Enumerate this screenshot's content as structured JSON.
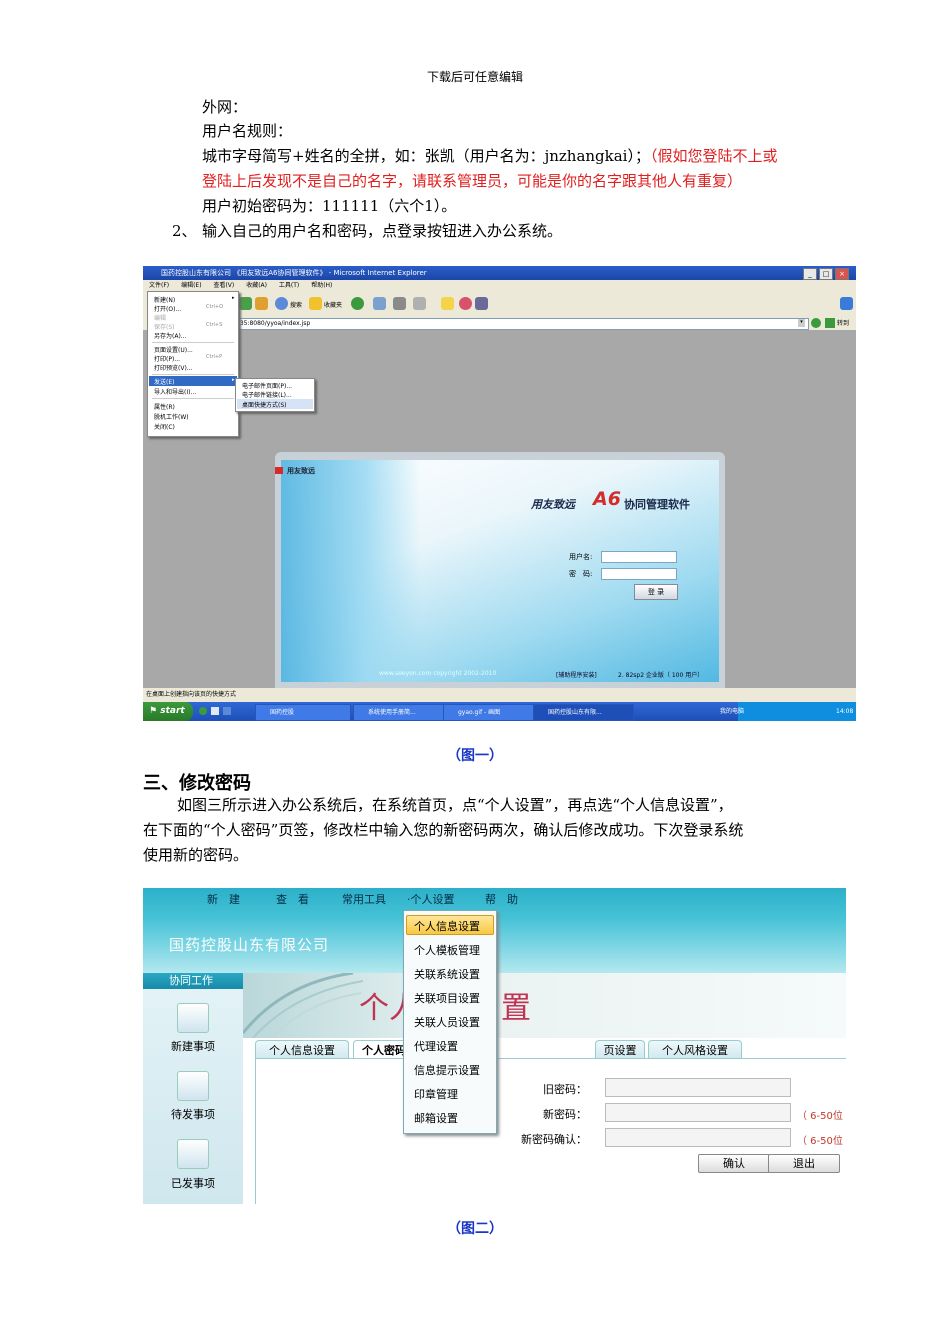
{
  "header": "下载后可任意编辑",
  "paragraphs": {
    "p1": "外网：",
    "p2": "用户名规则：",
    "p3a": "城市字母简写+姓名的全拼，如：张凯（用户名为：jnzhangkai）；",
    "p3b": "（假如您登陆不上或",
    "p4": "登陆上后发现不是自己的名字，请联系管理员，可能是你的名字跟其他人有重复）",
    "p5": "用户初始密码为：111111（六个1）。",
    "step2_num": "2、",
    "step2": "输入自己的用户名和密码，点登录按钮进入办公系统。"
  },
  "figure1": {
    "caption": "（图一）",
    "title_bar": "国药控股山东有限公司 《用友致远A6协同管理软件》 - Microsoft Internet Explorer",
    "menubar": [
      "文件(F)",
      "编辑(E)",
      "查看(V)",
      "收藏(A)",
      "工具(T)",
      "帮助(H)"
    ],
    "toolbar": {
      "search": "搜索",
      "favorites": "收藏夹"
    },
    "address": "235:8080/yyoa/index.jsp",
    "go": "转到",
    "file_menu": [
      {
        "label": "新建(N)",
        "shortcut": ""
      },
      {
        "label": "打开(O)...",
        "shortcut": "Ctrl+O"
      },
      {
        "label": "编辑",
        "shortcut": ""
      },
      {
        "label": "保存(S)",
        "shortcut": "Ctrl+S"
      },
      {
        "label": "另存为(A)...",
        "shortcut": ""
      },
      {
        "label": "页面设置(U)...",
        "shortcut": ""
      },
      {
        "label": "打印(P)...",
        "shortcut": "Ctrl+P"
      },
      {
        "label": "打印预览(V)...",
        "shortcut": ""
      },
      {
        "label": "发送(E)",
        "shortcut": ""
      },
      {
        "label": "导入和导出(I)...",
        "shortcut": ""
      },
      {
        "label": "属性(R)",
        "shortcut": ""
      },
      {
        "label": "脱机工作(W)",
        "shortcut": ""
      },
      {
        "label": "关闭(C)",
        "shortcut": ""
      }
    ],
    "send_submenu": [
      "电子邮件页面(P)...",
      "电子邮件链接(L)...",
      "桌面快捷方式(S)"
    ],
    "login": {
      "logo_small": "用友致远",
      "product_a": "用友致远",
      "product_logo": "A6",
      "product_b": "协同管理软件",
      "username_label": "用户名:",
      "password_label": "密　码:",
      "login_button": "登 录",
      "copyright": "www.seeyon.com copyright 2002-2010",
      "helper": "[辅助程序安装]",
      "version": "2. 82sp2  企业版（ 100  用户）"
    },
    "status": "在桌面上创建指向该页的快捷方式",
    "taskbar": {
      "start": "start",
      "tasks": [
        "国药控股",
        "系统使用手册简...",
        "gyao.gif - 画图",
        "国药控股山东有限..."
      ],
      "tray_label": "我的电脑",
      "time": "14:08"
    }
  },
  "section3": {
    "title": "三、修改密码",
    "body1": "如图三所示进入办公系统后，在系统首页，点“个人设置”，再点选“个人信息设置”，",
    "body2": "在下面的“个人密码”页签，修改栏中输入您的新密码两次，确认后修改成功。下次登录系统",
    "body3": "使用新的密码。"
  },
  "figure2": {
    "caption": "（图二）",
    "nav": [
      "新　建",
      "查　看",
      "常用工具",
      "·个人设置",
      "帮　助"
    ],
    "company": "国药控股山东有限公司",
    "left_head": "协同工作",
    "left_items": [
      "新建事项",
      "待发事项",
      "已发事项"
    ],
    "big_title_a": "个人",
    "big_title_b": "置",
    "tabs": [
      "个人信息设置",
      "个人密码",
      "页设置",
      "个人风格设置"
    ],
    "dropdown": [
      "个人信息设置",
      "个人模板管理",
      "关联系统设置",
      "关联项目设置",
      "关联人员设置",
      "代理设置",
      "信息提示设置",
      "印章管理",
      "邮箱设置"
    ],
    "form": {
      "old_label": "旧密码：",
      "new_label": "新密码：",
      "confirm_label": "新密码确认：",
      "hint": "（ 6-50位",
      "ok": "确认",
      "exit": "退出"
    }
  }
}
